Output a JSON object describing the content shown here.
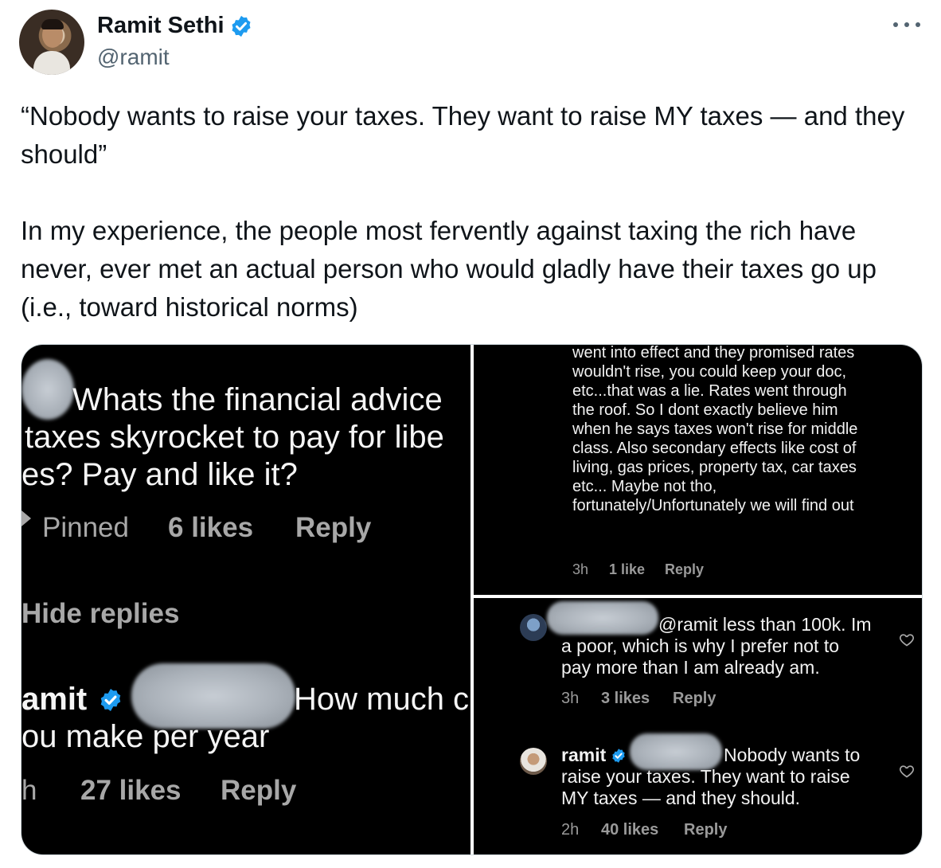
{
  "author": {
    "name": "Ramit Sethi",
    "handle": "@ramit"
  },
  "tweet": {
    "quote_line": "“Nobody wants to raise your taxes. They want to raise MY taxes — and they should”",
    "body": "In my experience, the people most fervently against taxing the rich have never, ever met an actual person who would gladly have their taxes go up (i.e., toward historical norms)"
  },
  "panel1": {
    "q_line1": "Whats the financial advice",
    "q_line2": "taxes skyrocket to pay for libe",
    "q_line3": "es? Pay and like it?",
    "pinned": "Pinned",
    "likes": "6 likes",
    "reply": "Reply",
    "hide_replies": "Hide replies",
    "reply_user": "amit",
    "reply_text1": "How much c",
    "reply_text2": "ou make per year",
    "time": "h",
    "reply_likes": "27 likes",
    "reply_reply": "Reply"
  },
  "panel2": {
    "text": "went into effect and they promised rates wouldn't rise, you could keep your doc, etc...that was a lie. Rates went through the roof. So I dont exactly believe him when he says taxes won't rise for middle class. Also secondary effects like cost of living, gas prices, property tax, car taxes etc... Maybe not tho, fortunately/Unfortunately we will find out",
    "time": "3h",
    "likes": "1 like",
    "reply": "Reply"
  },
  "panel3": {
    "comment1_tail": "@ramit less than 100k. Im",
    "comment1_rest": "a poor, which is why I prefer not to pay more than I am already am.",
    "comment1_time": "3h",
    "comment1_likes": "3 likes",
    "comment1_reply": "Reply",
    "comment2_user": "ramit",
    "comment2_tail": "Nobody wants to",
    "comment2_rest": "raise your taxes. They want to raise MY taxes — and they should.",
    "comment2_time": "2h",
    "comment2_likes": "40 likes",
    "comment2_reply": "Reply"
  },
  "colors": {
    "verified": "#1d9bf0",
    "panel_bg": "#000000",
    "secondary_text": "#536471"
  }
}
